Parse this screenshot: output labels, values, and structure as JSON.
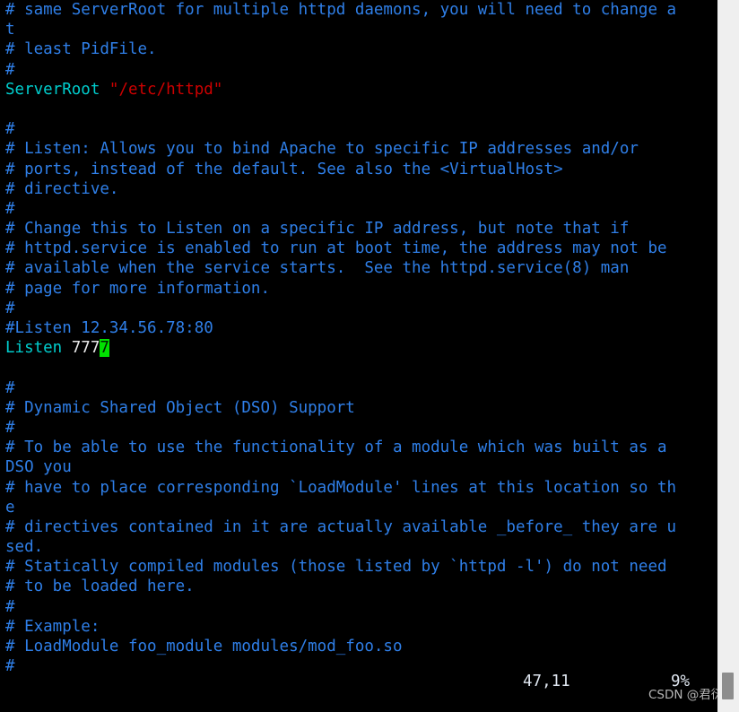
{
  "app": {
    "name": "vim-terminal",
    "file_kind": "apache-httpd-conf"
  },
  "colors": {
    "background": "#000000",
    "comment": "#2f7fe8",
    "directive": "#00cdcd",
    "string": "#cd0000",
    "value": "#e8e8e8",
    "cursor_bg": "#00e000",
    "status_text": "#dfe6f0",
    "scrollbar_track": "#efefef",
    "scrollbar_thumb": "#8d8d8d"
  },
  "editor": {
    "lines": [
      {
        "id": "l1",
        "text": "# same ServerRoot for multiple httpd daemons, you will need to change a",
        "style": "comment"
      },
      {
        "id": "l2",
        "text": "t",
        "style": "comment"
      },
      {
        "id": "l3",
        "text": "# least PidFile.",
        "style": "comment"
      },
      {
        "id": "l4",
        "text": "#",
        "style": "comment"
      },
      {
        "id": "l5",
        "text": "",
        "style": "serverroot"
      },
      {
        "id": "l6",
        "text": "",
        "style": "comment"
      },
      {
        "id": "l7",
        "text": "#",
        "style": "comment"
      },
      {
        "id": "l8",
        "text": "# Listen: Allows you to bind Apache to specific IP addresses and/or",
        "style": "comment"
      },
      {
        "id": "l9",
        "text": "# ports, instead of the default. See also the <VirtualHost>",
        "style": "comment"
      },
      {
        "id": "l10",
        "text": "# directive.",
        "style": "comment"
      },
      {
        "id": "l11",
        "text": "#",
        "style": "comment"
      },
      {
        "id": "l12",
        "text": "# Change this to Listen on a specific IP address, but note that if",
        "style": "comment"
      },
      {
        "id": "l13",
        "text": "# httpd.service is enabled to run at boot time, the address may not be",
        "style": "comment"
      },
      {
        "id": "l14",
        "text": "# available when the service starts.  See the httpd.service(8) man",
        "style": "comment"
      },
      {
        "id": "l15",
        "text": "# page for more information.",
        "style": "comment"
      },
      {
        "id": "l16",
        "text": "#",
        "style": "comment"
      },
      {
        "id": "l17",
        "text": "#Listen 12.34.56.78:80",
        "style": "comment"
      },
      {
        "id": "l18",
        "text": "",
        "style": "listen"
      },
      {
        "id": "l19",
        "text": "",
        "style": "comment"
      },
      {
        "id": "l20",
        "text": "#",
        "style": "comment"
      },
      {
        "id": "l21",
        "text": "# Dynamic Shared Object (DSO) Support",
        "style": "comment"
      },
      {
        "id": "l22",
        "text": "#",
        "style": "comment"
      },
      {
        "id": "l23",
        "text": "# To be able to use the functionality of a module which was built as a",
        "style": "comment"
      },
      {
        "id": "l24",
        "text": "DSO you",
        "style": "comment"
      },
      {
        "id": "l25",
        "text": "# have to place corresponding `LoadModule' lines at this location so th",
        "style": "comment"
      },
      {
        "id": "l26",
        "text": "e",
        "style": "comment"
      },
      {
        "id": "l27",
        "text": "# directives contained in it are actually available _before_ they are u",
        "style": "comment"
      },
      {
        "id": "l28",
        "text": "sed.",
        "style": "comment"
      },
      {
        "id": "l29",
        "text": "# Statically compiled modules (those listed by `httpd -l') do not need",
        "style": "comment"
      },
      {
        "id": "l30",
        "text": "# to be loaded here.",
        "style": "comment"
      },
      {
        "id": "l31",
        "text": "#",
        "style": "comment"
      },
      {
        "id": "l32",
        "text": "# Example:",
        "style": "comment"
      },
      {
        "id": "l33",
        "text": "# LoadModule foo_module modules/mod_foo.so",
        "style": "comment"
      },
      {
        "id": "l34",
        "text": "#",
        "style": "comment"
      }
    ],
    "serverroot_line": {
      "directive": "ServerRoot",
      "space": " ",
      "value": "\"/etc/httpd\""
    },
    "listen_line": {
      "directive": "Listen",
      "space": " ",
      "value": "777",
      "cursor_char": "7"
    }
  },
  "status": {
    "ruler": "47,11",
    "percent": "9%"
  },
  "watermark": {
    "text": "CSDN @君衍․"
  }
}
